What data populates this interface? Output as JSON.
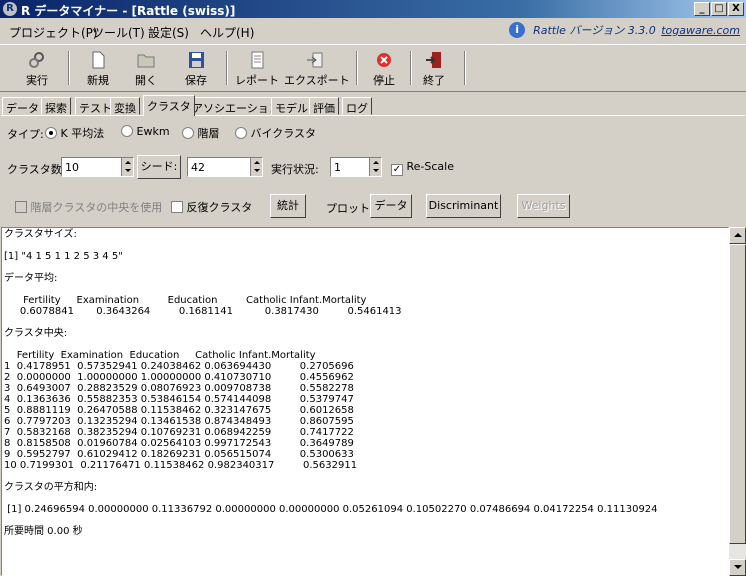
{
  "window": {
    "title": "R データマイナー - [Rattle (swiss)]",
    "app_letter": "R",
    "controls": [
      "_",
      "□",
      "X"
    ]
  },
  "menu": [
    "プロジェクト(P)",
    "ツール(T)",
    "設定(S)",
    "ヘルプ(H)"
  ],
  "version": {
    "info_glyph": "i",
    "text": "Rattle バージョン 3.3.0",
    "link": "togaware.com"
  },
  "toolbar": {
    "execute": "実行",
    "new": "新規",
    "open": "開く",
    "save": "保存",
    "report": "レポート",
    "export": "エクスポート",
    "stop": "停止",
    "quit": "終了"
  },
  "tabs": [
    "データ",
    "探索",
    "テスト",
    "変換",
    "クラスタ",
    "アソシエーション",
    "モデル",
    "評価",
    "ログ"
  ],
  "active_tab": "クラスタ",
  "cluster": {
    "type_label": "タイプ:",
    "types": [
      "K 平均法",
      "Ewkm",
      "階層",
      "バイクラスタ"
    ],
    "selected_type": "K 平均法",
    "count_label": "クラスタ数:",
    "count_value": "10",
    "seed_button": "シード:",
    "seed_value": "42",
    "runs_label": "実行状況:",
    "runs_value": "1",
    "rescale_label": "Re-Scale",
    "rescale_checked": true,
    "hier_center_label": "階層クラスタの中央を使用",
    "iterate_label": "反復クラスタ",
    "stats_button": "統計",
    "plot_label": "プロット:",
    "data_button": "データ",
    "discriminant_button": "Discriminant",
    "weights_button": "Weights"
  },
  "output": {
    "text": "クラスタサイズ:\n\n[1] \"4 1 5 1 1 2 5 3 4 5\"\n\nデータ平均:\n\n      Fertility     Examination         Education         Catholic Infant.Mortality\n     0.6078841       0.3643264         0.1681141          0.3817430         0.5461413\n\nクラスタ中央:\n\n    Fertility  Examination  Education     Catholic Infant.Mortality\n1  0.4178951  0.57352941 0.24038462 0.063694430         0.2705696\n2  0.0000000  1.00000000 1.00000000 0.410730710         0.4556962\n3  0.6493007  0.28823529 0.08076923 0.009708738         0.5582278\n4  0.1363636  0.55882353 0.53846154 0.574144098         0.5379747\n5  0.8881119  0.26470588 0.11538462 0.323147675         0.6012658\n6  0.7797203  0.13235294 0.13461538 0.874348493         0.8607595\n7  0.5832168  0.38235294 0.10769231 0.068942259         0.7417722\n8  0.8158508  0.01960784 0.02564103 0.997172543         0.3649789\n9  0.5952797  0.61029412 0.18269231 0.056515074         0.5300633\n10 0.7199301  0.21176471 0.11538462 0.982340317         0.5632911\n\nクラスタの平方和内:\n\n [1] 0.24696594 0.00000000 0.11336792 0.00000000 0.00000000 0.05261094 0.10502270 0.07486694 0.04172254 0.11130924\n\n所要時間 0.00 秒"
  }
}
